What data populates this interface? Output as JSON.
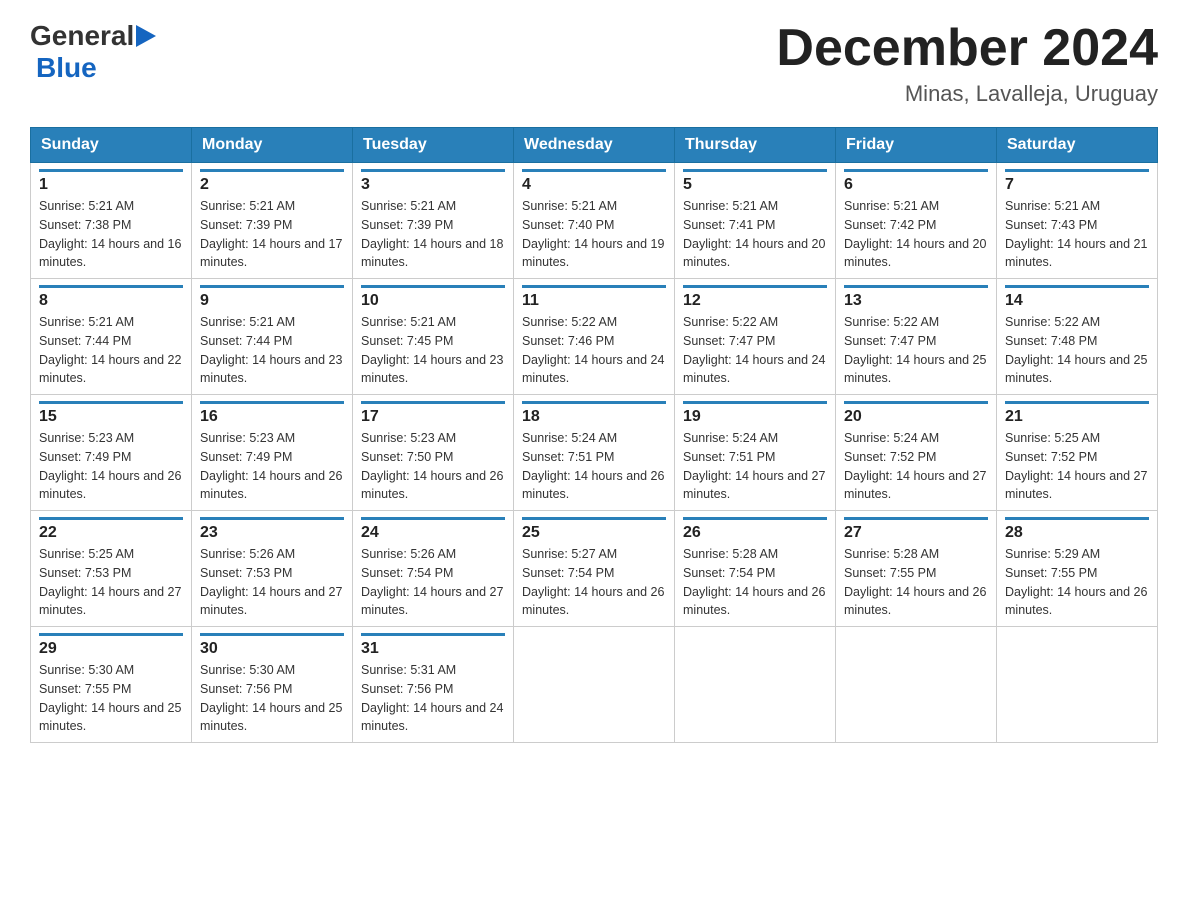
{
  "header": {
    "logo_general": "General",
    "logo_blue": "Blue",
    "month_title": "December 2024",
    "location": "Minas, Lavalleja, Uruguay"
  },
  "calendar": {
    "weekdays": [
      "Sunday",
      "Monday",
      "Tuesday",
      "Wednesday",
      "Thursday",
      "Friday",
      "Saturday"
    ],
    "weeks": [
      [
        {
          "day": "1",
          "sunrise": "5:21 AM",
          "sunset": "7:38 PM",
          "daylight": "14 hours and 16 minutes."
        },
        {
          "day": "2",
          "sunrise": "5:21 AM",
          "sunset": "7:39 PM",
          "daylight": "14 hours and 17 minutes."
        },
        {
          "day": "3",
          "sunrise": "5:21 AM",
          "sunset": "7:39 PM",
          "daylight": "14 hours and 18 minutes."
        },
        {
          "day": "4",
          "sunrise": "5:21 AM",
          "sunset": "7:40 PM",
          "daylight": "14 hours and 19 minutes."
        },
        {
          "day": "5",
          "sunrise": "5:21 AM",
          "sunset": "7:41 PM",
          "daylight": "14 hours and 20 minutes."
        },
        {
          "day": "6",
          "sunrise": "5:21 AM",
          "sunset": "7:42 PM",
          "daylight": "14 hours and 20 minutes."
        },
        {
          "day": "7",
          "sunrise": "5:21 AM",
          "sunset": "7:43 PM",
          "daylight": "14 hours and 21 minutes."
        }
      ],
      [
        {
          "day": "8",
          "sunrise": "5:21 AM",
          "sunset": "7:44 PM",
          "daylight": "14 hours and 22 minutes."
        },
        {
          "day": "9",
          "sunrise": "5:21 AM",
          "sunset": "7:44 PM",
          "daylight": "14 hours and 23 minutes."
        },
        {
          "day": "10",
          "sunrise": "5:21 AM",
          "sunset": "7:45 PM",
          "daylight": "14 hours and 23 minutes."
        },
        {
          "day": "11",
          "sunrise": "5:22 AM",
          "sunset": "7:46 PM",
          "daylight": "14 hours and 24 minutes."
        },
        {
          "day": "12",
          "sunrise": "5:22 AM",
          "sunset": "7:47 PM",
          "daylight": "14 hours and 24 minutes."
        },
        {
          "day": "13",
          "sunrise": "5:22 AM",
          "sunset": "7:47 PM",
          "daylight": "14 hours and 25 minutes."
        },
        {
          "day": "14",
          "sunrise": "5:22 AM",
          "sunset": "7:48 PM",
          "daylight": "14 hours and 25 minutes."
        }
      ],
      [
        {
          "day": "15",
          "sunrise": "5:23 AM",
          "sunset": "7:49 PM",
          "daylight": "14 hours and 26 minutes."
        },
        {
          "day": "16",
          "sunrise": "5:23 AM",
          "sunset": "7:49 PM",
          "daylight": "14 hours and 26 minutes."
        },
        {
          "day": "17",
          "sunrise": "5:23 AM",
          "sunset": "7:50 PM",
          "daylight": "14 hours and 26 minutes."
        },
        {
          "day": "18",
          "sunrise": "5:24 AM",
          "sunset": "7:51 PM",
          "daylight": "14 hours and 26 minutes."
        },
        {
          "day": "19",
          "sunrise": "5:24 AM",
          "sunset": "7:51 PM",
          "daylight": "14 hours and 27 minutes."
        },
        {
          "day": "20",
          "sunrise": "5:24 AM",
          "sunset": "7:52 PM",
          "daylight": "14 hours and 27 minutes."
        },
        {
          "day": "21",
          "sunrise": "5:25 AM",
          "sunset": "7:52 PM",
          "daylight": "14 hours and 27 minutes."
        }
      ],
      [
        {
          "day": "22",
          "sunrise": "5:25 AM",
          "sunset": "7:53 PM",
          "daylight": "14 hours and 27 minutes."
        },
        {
          "day": "23",
          "sunrise": "5:26 AM",
          "sunset": "7:53 PM",
          "daylight": "14 hours and 27 minutes."
        },
        {
          "day": "24",
          "sunrise": "5:26 AM",
          "sunset": "7:54 PM",
          "daylight": "14 hours and 27 minutes."
        },
        {
          "day": "25",
          "sunrise": "5:27 AM",
          "sunset": "7:54 PM",
          "daylight": "14 hours and 26 minutes."
        },
        {
          "day": "26",
          "sunrise": "5:28 AM",
          "sunset": "7:54 PM",
          "daylight": "14 hours and 26 minutes."
        },
        {
          "day": "27",
          "sunrise": "5:28 AM",
          "sunset": "7:55 PM",
          "daylight": "14 hours and 26 minutes."
        },
        {
          "day": "28",
          "sunrise": "5:29 AM",
          "sunset": "7:55 PM",
          "daylight": "14 hours and 26 minutes."
        }
      ],
      [
        {
          "day": "29",
          "sunrise": "5:30 AM",
          "sunset": "7:55 PM",
          "daylight": "14 hours and 25 minutes."
        },
        {
          "day": "30",
          "sunrise": "5:30 AM",
          "sunset": "7:56 PM",
          "daylight": "14 hours and 25 minutes."
        },
        {
          "day": "31",
          "sunrise": "5:31 AM",
          "sunset": "7:56 PM",
          "daylight": "14 hours and 24 minutes."
        },
        {
          "day": "",
          "sunrise": "",
          "sunset": "",
          "daylight": ""
        },
        {
          "day": "",
          "sunrise": "",
          "sunset": "",
          "daylight": ""
        },
        {
          "day": "",
          "sunrise": "",
          "sunset": "",
          "daylight": ""
        },
        {
          "day": "",
          "sunrise": "",
          "sunset": "",
          "daylight": ""
        }
      ]
    ]
  }
}
